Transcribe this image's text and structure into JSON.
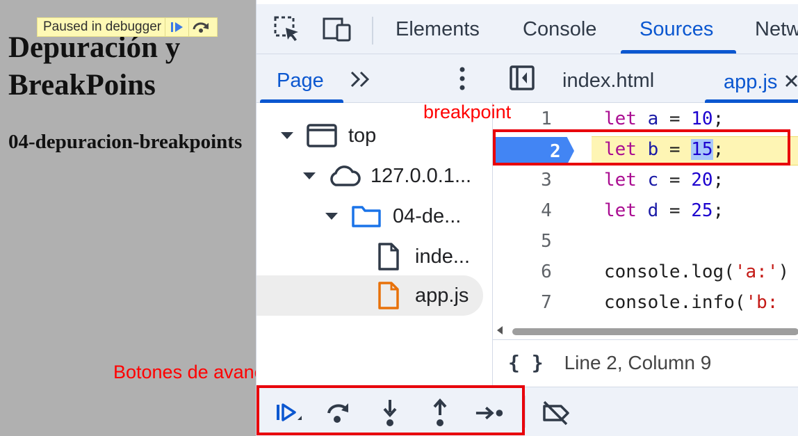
{
  "page": {
    "paused_banner": "Paused in debugger",
    "title": "Depuración y BreakPoins",
    "subtitle": "04-depuracion-breakpoints"
  },
  "annotations": {
    "breakpoint": "breakpoint",
    "stepping": "Botones de avance",
    "highlight_color": "#e8000b"
  },
  "devtools": {
    "main_tabs": [
      "Elements",
      "Console",
      "Sources",
      "Netw"
    ],
    "active_tab": "Sources",
    "navigator": {
      "tab": "Page",
      "tree": [
        {
          "label": "top",
          "icon": "frame-icon"
        },
        {
          "label": "127.0.0.1...",
          "icon": "cloud-icon"
        },
        {
          "label": "04-de...",
          "icon": "folder-icon"
        },
        {
          "label": "inde...",
          "icon": "file-icon"
        },
        {
          "label": "app.js",
          "icon": "js-file-icon",
          "selected": true
        }
      ]
    },
    "editor_tabs": [
      "index.html",
      "app.js"
    ],
    "active_editor_tab": "app.js",
    "code_lines": [
      {
        "n": "1"
      },
      {
        "n": "2",
        "breakpoint": true
      },
      {
        "n": "3"
      },
      {
        "n": "4"
      },
      {
        "n": "5"
      },
      {
        "n": "6"
      },
      {
        "n": "7"
      }
    ],
    "code_tokens": {
      "let": "let",
      "a": "a",
      "b": "b",
      "c": "c",
      "d": "d",
      "v10": "10",
      "v15": "15",
      "v20": "20",
      "v25": "25",
      "eq": " = ",
      "semi": ";",
      "console": "console",
      "log": ".log(",
      "info": ".info(",
      "str_a": "'a:'",
      "str_b": "'b:",
      "tail6": ")"
    },
    "status": {
      "format_icon": "{ }",
      "position": "Line 2, Column 9"
    },
    "debugger_buttons": [
      "resume-icon",
      "step-over-icon",
      "step-into-icon",
      "step-out-icon",
      "step-icon",
      "deactivate-breakpoints-icon"
    ],
    "colors": {
      "accent": "#0b57d0",
      "breakpoint_marker": "#4285f4",
      "paused_line": "#fef5b4"
    }
  }
}
